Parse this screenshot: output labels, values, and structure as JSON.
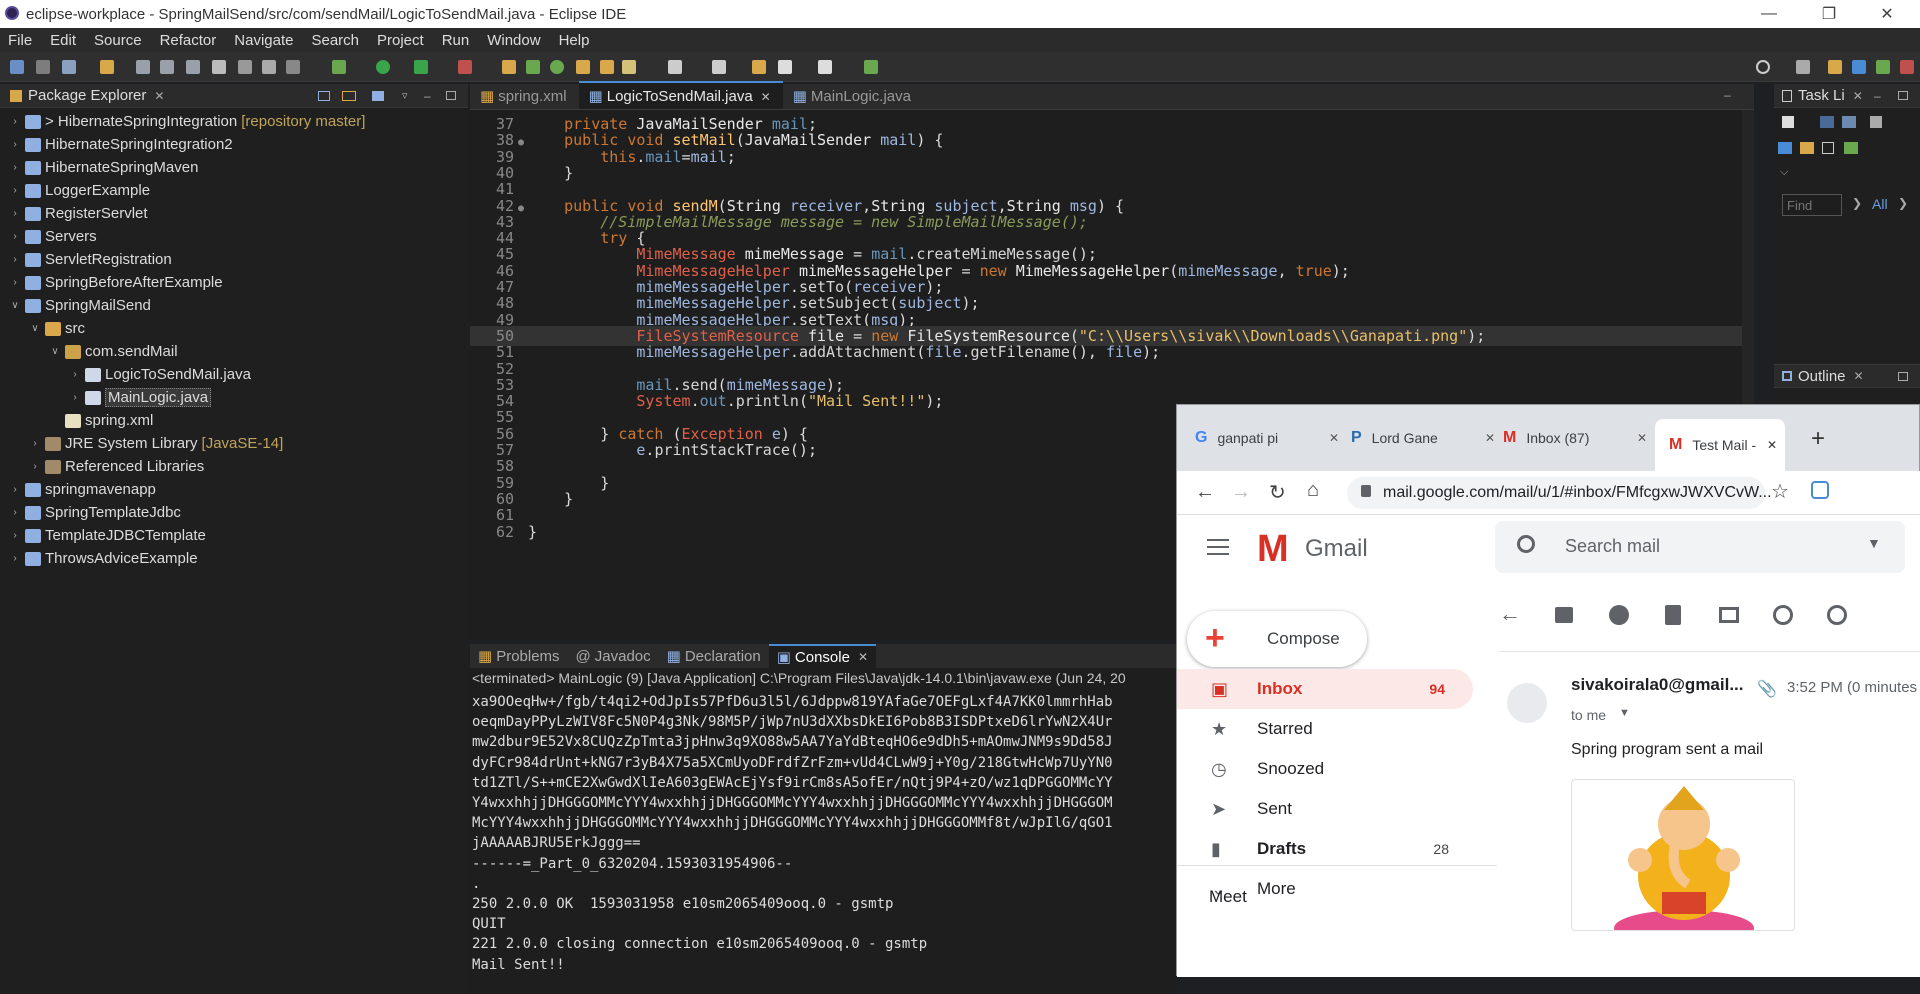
{
  "window": {
    "title": "eclipse-workplace - SpringMailSend/src/com/sendMail/LogicToSendMail.java - Eclipse IDE"
  },
  "menu": [
    "File",
    "Edit",
    "Source",
    "Refactor",
    "Navigate",
    "Search",
    "Project",
    "Run",
    "Window",
    "Help"
  ],
  "package_explorer": {
    "title": "Package Explorer",
    "items": [
      {
        "label": "> HibernateSpringIntegration",
        "deco": "[repository master]",
        "depth": 0
      },
      {
        "label": "HibernateSpringIntegration2",
        "depth": 0
      },
      {
        "label": "HibernateSpringMaven",
        "depth": 0
      },
      {
        "label": "LoggerExample",
        "depth": 0
      },
      {
        "label": "RegisterServlet",
        "depth": 0
      },
      {
        "label": "Servers",
        "depth": 0
      },
      {
        "label": "ServletRegistration",
        "depth": 0
      },
      {
        "label": "SpringBeforeAfterExample",
        "depth": 0
      },
      {
        "label": "SpringMailSend",
        "depth": 0
      },
      {
        "label": "src",
        "depth": 1
      },
      {
        "label": "com.sendMail",
        "depth": 2
      },
      {
        "label": "LogicToSendMail.java",
        "depth": 3
      },
      {
        "label": "MainLogic.java",
        "depth": 3
      },
      {
        "label": "spring.xml",
        "depth": 2
      },
      {
        "label": "JRE System Library",
        "deco": "[JavaSE-14]",
        "depth": 1
      },
      {
        "label": "Referenced Libraries",
        "depth": 1
      },
      {
        "label": "springmavenapp",
        "depth": 0
      },
      {
        "label": "SpringTemplateJdbc",
        "depth": 0
      },
      {
        "label": "TemplateJDBCTemplate",
        "depth": 0
      },
      {
        "label": "ThrowsAdviceExample",
        "depth": 0
      }
    ]
  },
  "editor": {
    "tabs": [
      "spring.xml",
      "LogicToSendMail.java",
      "MainLogic.java"
    ],
    "lines": [
      {
        "n": "37",
        "html": "    <span class='k'>private</span> <span class='t'>JavaMailSender</span> <span class='f'>mail</span>;"
      },
      {
        "n": "38",
        "html": "    <span class='k'>public void</span> <span class='m'>setMail</span>(<span class='t'>JavaMailSender</span> <span class='v'>mail</span>) {"
      },
      {
        "n": "39",
        "html": "        <span class='k'>this</span>.<span class='f'>mail</span>=<span class='v'>mail</span>;"
      },
      {
        "n": "40",
        "html": "    }"
      },
      {
        "n": "41",
        "html": ""
      },
      {
        "n": "42",
        "html": "    <span class='k'>public void</span> <span class='m'>sendM</span>(<span class='t'>String</span> <span class='v'>receiver</span>,<span class='t'>String</span> <span class='v'>subject</span>,<span class='t'>String</span> <span class='v'>msg</span>) {"
      },
      {
        "n": "43",
        "html": "        <span class='c'>//SimpleMailMessage message = new SimpleMailMessage();</span>"
      },
      {
        "n": "44",
        "html": "        <span class='k'>try</span> {"
      },
      {
        "n": "45",
        "html": "            <span class='r'>MimeMessage</span> <span class='t'>mimeMessage</span> = <span class='f'>mail</span>.<span class='p'>createMimeMessage</span>();"
      },
      {
        "n": "46",
        "html": "            <span class='r'>MimeMessageHelper</span> <span class='t'>mimeMessageHelper</span> = <span class='k'>new</span> <span class='t'>MimeMessageHelper</span>(<span class='v'>mimeMessage</span>, <span class='k'>true</span>);"
      },
      {
        "n": "47",
        "html": "            <span class='v'>mimeMessageHelper</span>.<span class='p'>setTo</span>(<span class='v'>receiver</span>);"
      },
      {
        "n": "48",
        "html": "            <span class='v'>mimeMessageHelper</span>.<span class='p'>setSubject</span>(<span class='v'>subject</span>);"
      },
      {
        "n": "49",
        "html": "            <span class='v'>mimeMessageHelper</span>.<span class='p'>setText</span>(<span class='v'>msg</span>);"
      },
      {
        "n": "50",
        "html": "            <span class='r'>FileSystemResource</span> <span class='t'>file</span> = <span class='k'>new</span> <span class='t'>FileSystemResource</span>(<span class='s'>\"C:\\\\Users\\\\sivak\\\\Downloads\\\\Ganapati.png\"</span>);"
      },
      {
        "n": "51",
        "html": "            <span class='v'>mimeMessageHelper</span>.<span class='p'>addAttachment</span>(<span class='v'>file</span>.<span class='p'>getFilename</span>(), <span class='v'>file</span>);"
      },
      {
        "n": "52",
        "html": ""
      },
      {
        "n": "53",
        "html": "            <span class='f'>mail</span>.<span class='p'>send</span>(<span class='v'>mimeMessage</span>);"
      },
      {
        "n": "54",
        "html": "            <span class='r'>System</span>.<span class='f'>out</span>.<span class='p'>println</span>(<span class='s'>\"Mail Sent!!\"</span>);"
      },
      {
        "n": "55",
        "html": ""
      },
      {
        "n": "56",
        "html": "        } <span class='k'>catch</span> (<span class='r'>Exception</span> <span class='v'>e</span>) {"
      },
      {
        "n": "57",
        "html": "            <span class='v'>e</span>.<span class='p'>printStackTrace</span>();"
      },
      {
        "n": "58",
        "html": ""
      },
      {
        "n": "59",
        "html": "        }"
      },
      {
        "n": "60",
        "html": "    }"
      },
      {
        "n": "61",
        "html": ""
      },
      {
        "n": "62",
        "html": "}"
      }
    ]
  },
  "console": {
    "tabs": [
      "Problems",
      "Javadoc",
      "Declaration",
      "Console"
    ],
    "header": "<terminated> MainLogic (9) [Java Application] C:\\Program Files\\Java\\jdk-14.0.1\\bin\\javaw.exe  (Jun 24, 20",
    "lines": [
      "xa9OOeqHw+/fgb/t4qi2+OdJpIs57PfD6u3l5l/6Jdppw819YAfaGe7OEFgLxf4A7KK0lmmrhHab",
      "oeqmDayPPyLzWIV8Fc5N0P4g3Nk/98M5P/jWp7nU3dXXbsDkEI6Pob8B3ISDPtxeD6lrYwN2X4Ur",
      "mw2dbur9E52Vx8CUQzZpTmta3jpHnw3q9XO88w5AA7YaYdBteqHO6e9dDh5+mAOmwJNM9s9Dd58J",
      "dyFCr984drUnt+kNG7r3yB4X75a5XCmUyoDFrdfZrFzm+vUd4CLwW9j+Y0g/218GtwHcWp7UyYN0",
      "td1ZTl/S++mCE2XwGwdXlIeA603gEWAcEjYsf9irCm8sA5ofEr/nQtj9P4+zO/wz1qDPGGOMMcYY",
      "Y4wxxhhjjDHGGGOMMcYYY4wxxhhjjDHGGGOMMcYYY4wxxhhjjDHGGGOMMcYYY4wxxhhjjDHGGGOM",
      "McYYY4wxxhhjjDHGGGOMMcYYY4wxxhhjjDHGGGOMMcYYY4wxxhhjjDHGGGOMMf8t/wJpIlG/qGO1",
      "jAAAAABJRU5ErkJggg==",
      "------=_Part_0_6320204.1593031954906--",
      ".",
      "250 2.0.0 OK  1593031958 e10sm2065409ooq.0 - gsmtp",
      "QUIT",
      "221 2.0.0 closing connection e10sm2065409ooq.0 - gsmtp",
      "Mail Sent!!"
    ]
  },
  "task_list": {
    "title": "Task Li",
    "find_placeholder": "Find",
    "all": "All"
  },
  "outline": {
    "title": "Outline"
  },
  "browser": {
    "tabs": [
      "ganpati pi",
      "Lord Gane",
      "Inbox (87)",
      "Test Mail -"
    ],
    "url": "mail.google.com/mail/u/1/#inbox/FMfcgxwJWXVCvW...",
    "gmail": {
      "brand": "Gmail",
      "search_placeholder": "Search mail",
      "compose": "Compose",
      "nav": [
        {
          "label": "Inbox",
          "count": "94",
          "icon": "inbox-icon"
        },
        {
          "label": "Starred",
          "count": "",
          "icon": "star-icon"
        },
        {
          "label": "Snoozed",
          "count": "",
          "icon": "clock-icon"
        },
        {
          "label": "Sent",
          "count": "",
          "icon": "send-icon"
        },
        {
          "label": "Drafts",
          "count": "28",
          "icon": "draft-icon"
        },
        {
          "label": "More",
          "count": "",
          "icon": "chevron-down-icon"
        }
      ],
      "meet": "Meet",
      "message": {
        "sender": "sivakoirala0@gmail...",
        "time": "3:52 PM (0 minutes",
        "to": "to me",
        "body": "Spring program sent a mail"
      }
    }
  }
}
